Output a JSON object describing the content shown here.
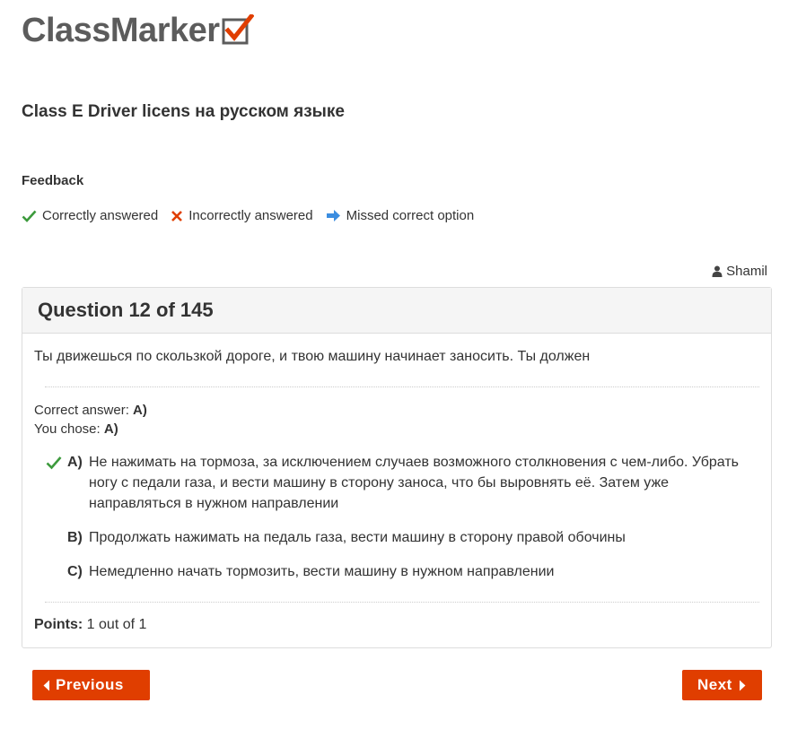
{
  "brand": {
    "name": "ClassMarker",
    "accent": "#e03e00"
  },
  "quiz": {
    "title": "Class E Driver licens на русском языке"
  },
  "feedback": {
    "heading": "Feedback",
    "legend": [
      {
        "icon": "check-icon",
        "color": "#3c9a3c",
        "label": "Correctly answered"
      },
      {
        "icon": "cross-icon",
        "color": "#e03e00",
        "label": "Incorrectly answered"
      },
      {
        "icon": "arrow-right-icon",
        "color": "#3b8de0",
        "label": "Missed correct option"
      }
    ]
  },
  "user": {
    "name": "Shamil",
    "icon": "user-icon"
  },
  "question": {
    "header": "Question 12 of 145",
    "text": "Ты движешься по скользкой дороге, и твою машину начинает заносить. Ты должен",
    "correct_label": "Correct answer:",
    "correct_value": "A)",
    "chosen_label": "You chose:",
    "chosen_value": "A)",
    "options": [
      {
        "letter": "A)",
        "text": "Не нажимать на тормоза, за исключением случаев возможного столкновения с чем-либо. Убрать ногу с педали газа, и вести машину в сторону заноса, что бы выровнять её. Затем уже направляться в нужном направлении",
        "mark": "check-icon"
      },
      {
        "letter": "B)",
        "text": "Продолжать нажимать на педаль газа, вести машину в сторону правой обочины",
        "mark": ""
      },
      {
        "letter": "C)",
        "text": "Немедленно начать тормозить, вести машину в нужном направлении",
        "mark": ""
      }
    ],
    "points_label": "Points:",
    "points_value": "1 out of 1"
  },
  "nav": {
    "previous_label": "Previous",
    "next_label": "Next"
  }
}
